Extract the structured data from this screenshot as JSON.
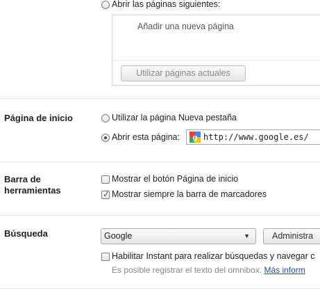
{
  "startup": {
    "open_pages_label": "Abrir las páginas siguientes:",
    "add_page_placeholder": "Añadir una nueva página",
    "use_current_button": "Utilizar páginas actuales"
  },
  "home_page": {
    "section_label": "Página de inicio",
    "new_tab_option": "Utilizar la página Nueva pestaña",
    "open_page_option": "Abrir esta página:",
    "url_value": "http://www.google.es/"
  },
  "toolbar": {
    "section_label": "Barra de herramientas",
    "show_home_button": "Mostrar el botón Página de inicio",
    "show_home_button_checked": false,
    "show_bookmarks_bar": "Mostrar siempre la barra de marcadores",
    "show_bookmarks_bar_checked": true
  },
  "search": {
    "section_label": "Búsqueda",
    "engine_selected": "Google",
    "manage_button": "Administra",
    "instant_label": "Habilitar Instant para realizar búsquedas y navegar c",
    "instant_checked": false,
    "help_text": "Es posible registrar el texto del omnibox.",
    "more_info_link": "Más inform"
  }
}
